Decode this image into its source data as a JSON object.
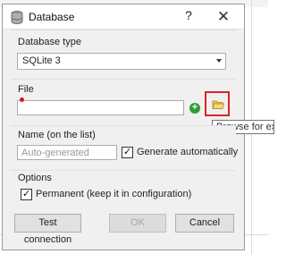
{
  "window": {
    "title": "Database",
    "help_label": "?",
    "close_label": "✕"
  },
  "database_type": {
    "label": "Database type",
    "selected": "SQLite 3"
  },
  "file": {
    "label": "File",
    "value": "",
    "tooltip": "Browse for existing database"
  },
  "name": {
    "label": "Name (on the list)",
    "placeholder": "Auto-generated",
    "generate_label": "Generate automatically",
    "generate_checked": true
  },
  "options": {
    "label": "Options",
    "permanent_label": "Permanent (keep it in configuration)",
    "permanent_checked": true
  },
  "buttons": {
    "test": "Test connection",
    "ok": "OK",
    "cancel": "Cancel"
  },
  "colors": {
    "highlight_border": "#d8232a",
    "add_button": "#2d9d38"
  }
}
